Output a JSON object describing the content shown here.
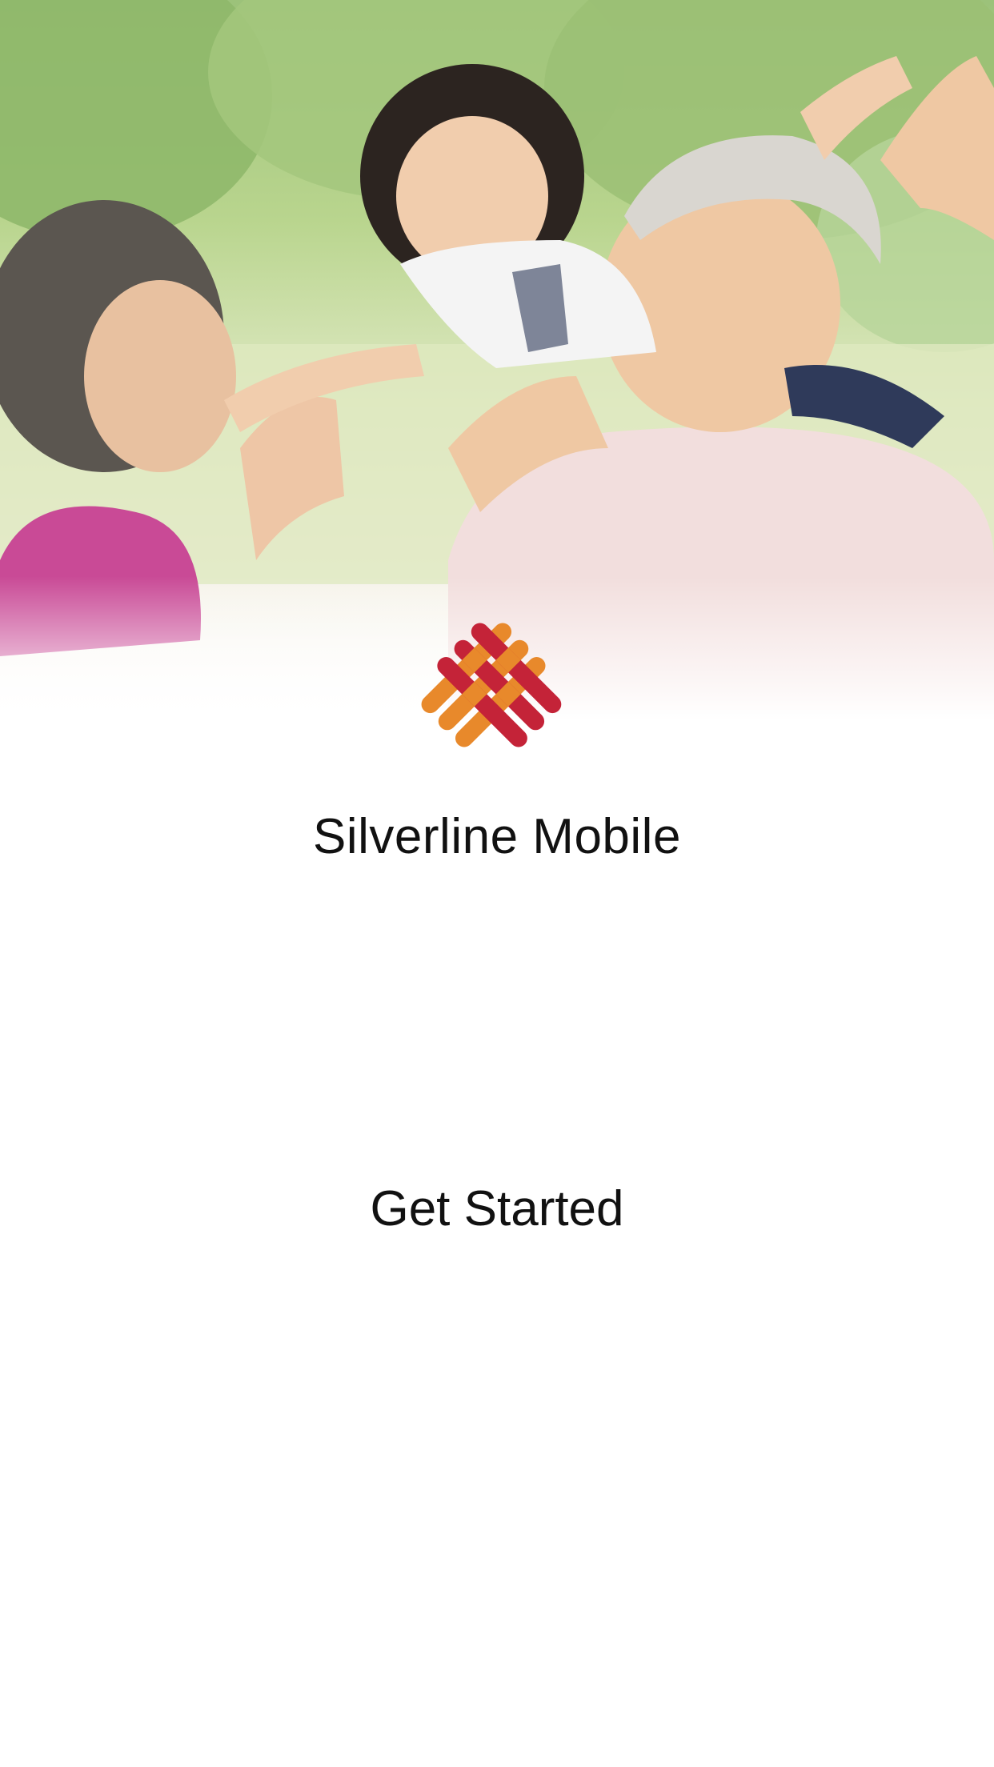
{
  "hero": {
    "image_subject": "family-photo"
  },
  "logo": {
    "icon": "woven-heart-logo",
    "colors": [
      "#e8892b",
      "#c42338"
    ]
  },
  "app": {
    "title": "Silverline Mobile"
  },
  "actions": {
    "get_started_label": "Get Started"
  }
}
